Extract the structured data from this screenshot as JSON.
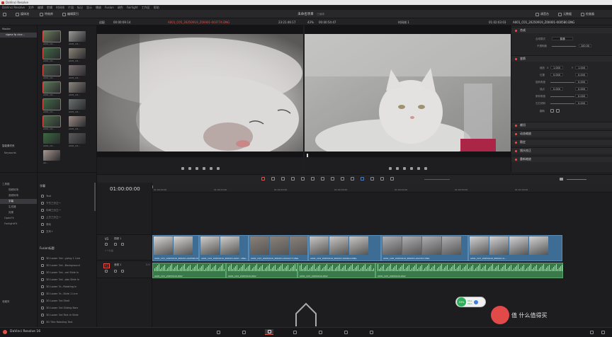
{
  "app": {
    "window_title": "DaVinci Resolve"
  },
  "menubar": [
    "DaVinci Resolve",
    "文件",
    "编辑",
    "剪辑",
    "时间线",
    "片段",
    "标记",
    "显示",
    "播放",
    "Fusion",
    "调色",
    "Fairlight",
    "工作区",
    "帮助"
  ],
  "toolbar": {
    "media_pool": "媒体池",
    "effects": "特效库",
    "edit_index": "编辑索引",
    "project_name": "未命名项目",
    "project_status": "已编辑",
    "mixer": "调音台",
    "metadata": "元数据",
    "inspector": "检查器"
  },
  "viewer": {
    "source_zoom": "适配",
    "source_tc_left": "00:00:09:14",
    "source_clip": "A001_C05_20250919_Z00001-003774.DNG",
    "source_tc_right": "23:21:46:17",
    "program_zoom": "43%",
    "program_tc_left": "00:00:54:47",
    "timeline_name": "时间线 1",
    "program_tc_right": "01:02:03:03",
    "inspector_clip": "A001_C01_20250919_Z00001-000580.DNG"
  },
  "left_panel": {
    "master": "Master",
    "bin": "sigma fp cine...",
    "smart_bins": "智能素材夹",
    "keywords": "Keywords"
  },
  "media_pool": {
    "clips": [
      {
        "label": "A001_C0...",
        "color": "#6a7a5a",
        "selected": true
      },
      {
        "label": "A001_C0...",
        "color": "#9a9a98",
        "selected": false
      },
      {
        "label": "A001_C0...",
        "color": "#3f6b45",
        "selected": true
      },
      {
        "label": "A001_C0...",
        "color": "#8a8478",
        "selected": false
      },
      {
        "label": "A001_C0...",
        "color": "#4a5a4a",
        "selected": true
      },
      {
        "label": "A001_C0...",
        "color": "#7a7070",
        "selected": false
      },
      {
        "label": "A001_C0...",
        "color": "#5a7a5a",
        "selected": true
      },
      {
        "label": "A001_C0...",
        "color": "#8c8680",
        "selected": false
      },
      {
        "label": "A001_C0...",
        "color": "#3f6b45",
        "selected": true
      },
      {
        "label": "A001_C0...",
        "color": "#6a7070",
        "selected": false
      },
      {
        "label": "A001_C0...",
        "color": "#4a6a4a",
        "selected": true
      },
      {
        "label": "A001_C0...",
        "color": "#9a8a84",
        "selected": false
      },
      {
        "label": "A001_C0...",
        "color": "#3a6a40",
        "selected": false
      },
      {
        "label": "A001_C0...",
        "color": "#5a5a5a",
        "selected": false
      },
      {
        "label": "A0...",
        "color": "#a89890",
        "selected": false
      }
    ]
  },
  "inspector": {
    "composite": "合成",
    "blend_mode_label": "合成模式",
    "blend_mode_value": "普通",
    "opacity_label": "不透明度",
    "opacity_value": "100.00",
    "transform": "变换",
    "zoom_label": "缩放",
    "zoom_x": "1.000",
    "zoom_y": "1.000",
    "position_label": "位置",
    "position_x": "0.000",
    "position_y": "0.000",
    "rotation_label": "旋转角度",
    "rotation_value": "0.000",
    "anchor_label": "锚点",
    "anchor_x": "0.000",
    "anchor_y": "0.000",
    "pitch_label": "俯仰角度",
    "pitch_value": "0.000",
    "yaw_label": "左右倾斜",
    "yaw_value": "0.000",
    "flip_label": "翻转",
    "cropping": "裁切",
    "dynamic_zoom": "动态缩放",
    "stabilization": "稳定",
    "lens_correction": "镜头校正",
    "retime_scaling": "重新缩放"
  },
  "timeline": {
    "timecode": "01:00:00:00",
    "ruler": [
      "01:00:00:00",
      "01:00:10:00",
      "01:00:20:00",
      "01:00:30:00",
      "01:00:40:00",
      "01:00:50:00",
      "01:01:00:00"
    ],
    "video_track": "V1",
    "video_track_name": "视频 1",
    "video_track_info": "7 个片段",
    "audio_track": "A1",
    "audio_track_name": "音频 1",
    "audio_track_level": "2.0",
    "video_clips": [
      {
        "label": "A001_C01_20250919_Z00001-000580.DNG"
      },
      {
        "label": "A001_C02_20250919_Z00001-0007...DNG"
      },
      {
        "label": "A001_C03_20250919_Z00001-0004177.DNG"
      },
      {
        "label": "A001_C04_20250919_Z00001-000610.DNG"
      },
      {
        "label": "A001_C05_20250919_Z00001-003774.DNG"
      },
      {
        "label": "A001_C06_20250919_Z00001-002347.DNG"
      },
      {
        "label": "A001_C07_20250919_Z00001-0..."
      }
    ],
    "audio_clips": [
      {
        "label": "A001_C01_20250919.WAV"
      },
      {
        "label": "A001_C02_20250919.WAV"
      },
      {
        "label": "A001_C03_20250919.WAV"
      },
      {
        "label": "A001_C05_20250919.WAV"
      }
    ]
  },
  "effects_panel": {
    "toolbox": "工具箱",
    "video_transitions": "视频转场",
    "audio_transitions": "音频转场",
    "titles": "字幕",
    "generators": "生成器",
    "effects": "效果",
    "openfx": "OpenFX",
    "fairlight_fx": "FairlightFX",
    "favorites": "收藏夹",
    "titles_header": "字幕",
    "title_items": [
      "Text",
      "下方三分之一",
      "中间三分之一",
      "上方三分之一",
      "滚动",
      "文本+"
    ],
    "fusion_header": "Fusion标题",
    "fusion_items": [
      "3D Lower 3rd...yping 1 Line",
      "3D Lower 3rd...Background",
      "3D Lower 3rd...nel Slide In",
      "3D Lower 3rd...abs Slide In",
      "3D Lower 3r...Rotating In",
      "3D Lower 3r...Slide 1 Line",
      "3D Lower 3rd Shelf",
      "3D Lower 3rd Sliding Bars",
      "3D Lower 3rd Text In Slide",
      "3D Title Rotating Text"
    ]
  },
  "status": {
    "app_name": "DaVinci Resolve 16",
    "cpu_percent": "53%",
    "net_up": "0K/s",
    "net_down": "0K/s"
  },
  "watermark": "值 什么值得买"
}
